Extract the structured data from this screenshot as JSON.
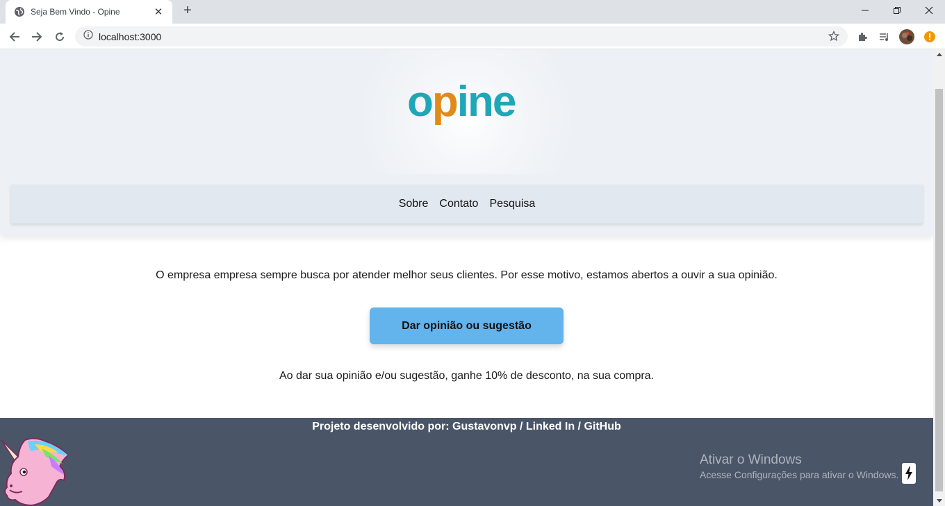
{
  "browser": {
    "tab_title": "Seja Bem Vindo - Opine",
    "new_tab": "+",
    "url": "localhost:3000"
  },
  "site": {
    "logo": {
      "part1": "o",
      "part2": "p",
      "part3": "ine"
    },
    "nav": [
      "Sobre",
      "Contato",
      "Pesquisa"
    ],
    "intro": "O empresa empresa sempre busca por atender melhor seus clientes. Por esse motivo, estamos abertos a ouvir a sua opinião.",
    "cta_label": "Dar opinião ou sugestão",
    "promo": "Ao dar sua opinião e/ou sugestão, ganhe 10% de desconto, na sua compra.",
    "footer": {
      "prefix": "Projeto desenvolvido por: ",
      "author": "Gustavonvp",
      "sep1": " / ",
      "linkedin": "Linked In",
      "sep2": " / ",
      "github": "GitHub"
    }
  },
  "watermark": {
    "title": "Ativar o Windows",
    "subtitle": "Acesse Configurações para ativar o Windows."
  },
  "colors": {
    "logo_teal": "#1fa7b8",
    "logo_orange": "#e08a1a",
    "nav_bg": "#e2e8f0",
    "cta_bg": "#63b3ed",
    "footer_bg": "#4a5568"
  }
}
